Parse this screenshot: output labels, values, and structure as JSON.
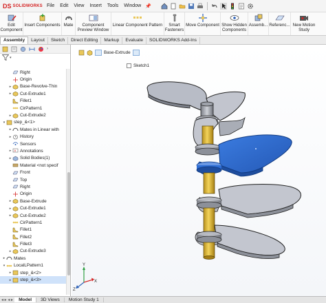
{
  "app": {
    "logo_mark": "DS",
    "logo_text": "SOLIDWORKS"
  },
  "menu": [
    "File",
    "Edit",
    "View",
    "Insert",
    "Tools",
    "Window"
  ],
  "ribbon": [
    {
      "label": "Edit\nComponent",
      "icon": "edit-component-icon"
    },
    {
      "label": "Insert Components",
      "icon": "insert-components-icon"
    },
    {
      "label": "Mate",
      "icon": "mate-icon"
    },
    {
      "label": "Component\nPreview Window",
      "icon": "preview-window-icon"
    },
    {
      "label": "Linear Component Pattern",
      "icon": "linear-pattern-icon"
    },
    {
      "label": "Smart\nFasteners",
      "icon": "smart-fasteners-icon"
    },
    {
      "label": "Move Component",
      "icon": "move-component-icon"
    },
    {
      "label": "Show Hidden\nComponents",
      "icon": "show-hidden-icon"
    },
    {
      "label": "Assemb...",
      "icon": "assembly-features-icon"
    },
    {
      "label": "Referenc...",
      "icon": "reference-geometry-icon"
    },
    {
      "label": "New Motion\nStudy",
      "icon": "motion-study-icon"
    }
  ],
  "command_tabs": [
    "Assembly",
    "Layout",
    "Sketch",
    "Direct Editing",
    "Markup",
    "Evaluate",
    "SOLIDWORKS Add-Ins"
  ],
  "tree": [
    {
      "label": "Right",
      "icon": "plane",
      "indent": 0,
      "exp": ""
    },
    {
      "label": "Origin",
      "icon": "origin",
      "indent": 0,
      "exp": ""
    },
    {
      "label": "Base-Revolve-Thin",
      "icon": "feature",
      "indent": 0,
      "exp": "▸"
    },
    {
      "label": "Cut-Extrude1",
      "icon": "feature",
      "indent": 0,
      "exp": "▸"
    },
    {
      "label": "Fillet1",
      "icon": "fillet",
      "indent": 0,
      "exp": ""
    },
    {
      "label": "CirPattern1",
      "icon": "pattern",
      "indent": 0,
      "exp": ""
    },
    {
      "label": "Cut-Extrude2",
      "icon": "feature",
      "indent": 0,
      "exp": "▸"
    },
    {
      "label": "step_&<1>",
      "icon": "part",
      "indent": -1,
      "exp": "▾"
    },
    {
      "label": "Mates in Linear with",
      "icon": "mates",
      "indent": 0,
      "exp": "▸"
    },
    {
      "label": "History",
      "icon": "history",
      "indent": 0,
      "exp": "▸"
    },
    {
      "label": "Sensors",
      "icon": "sensor",
      "indent": 0,
      "exp": ""
    },
    {
      "label": "Annotations",
      "icon": "annotation",
      "indent": 0,
      "exp": "▸"
    },
    {
      "label": "Solid Bodies(1)",
      "icon": "body",
      "indent": 0,
      "exp": "▸"
    },
    {
      "label": "Material <not specif",
      "icon": "material",
      "indent": 0,
      "exp": ""
    },
    {
      "label": "Front",
      "icon": "plane",
      "indent": 0,
      "exp": ""
    },
    {
      "label": "Top",
      "icon": "plane",
      "indent": 0,
      "exp": ""
    },
    {
      "label": "Right",
      "icon": "plane",
      "indent": 0,
      "exp": ""
    },
    {
      "label": "Origin",
      "icon": "origin",
      "indent": 0,
      "exp": ""
    },
    {
      "label": "Base-Extrude",
      "icon": "feature",
      "indent": 0,
      "exp": "▸"
    },
    {
      "label": "Cut-Extrude1",
      "icon": "feature",
      "indent": 0,
      "exp": "▸"
    },
    {
      "label": "Cut-Extrude2",
      "icon": "feature",
      "indent": 0,
      "exp": "▸"
    },
    {
      "label": "CirPattern1",
      "icon": "pattern",
      "indent": 0,
      "exp": ""
    },
    {
      "label": "Fillet1",
      "icon": "fillet",
      "indent": 0,
      "exp": ""
    },
    {
      "label": "Fillet2",
      "icon": "fillet",
      "indent": 0,
      "exp": ""
    },
    {
      "label": "Fillet3",
      "icon": "fillet",
      "indent": 0,
      "exp": ""
    },
    {
      "label": "Cut-Extrude3",
      "icon": "feature",
      "indent": 0,
      "exp": "▸"
    },
    {
      "label": "Mates",
      "icon": "mates",
      "indent": -1,
      "exp": "▸"
    },
    {
      "label": "LocalLPattern1",
      "icon": "pattern",
      "indent": -1,
      "exp": "▾"
    },
    {
      "label": "step_&<2>",
      "icon": "part",
      "indent": 0,
      "exp": "▸"
    },
    {
      "label": "step_&<3>",
      "icon": "part",
      "indent": 0,
      "exp": "▸",
      "selected": true
    }
  ],
  "viewport": {
    "breadcrumb_feature": "Base-Extrude",
    "sketch_label": "Sketch1"
  },
  "bottom_tabs": [
    "Model",
    "3D Views",
    "Motion Study 1"
  ],
  "colors": {
    "step_selected": "#2f6fd6",
    "step_default": "#b9bcc4",
    "column": "#d7b13a",
    "accent_red": "#d42121"
  }
}
